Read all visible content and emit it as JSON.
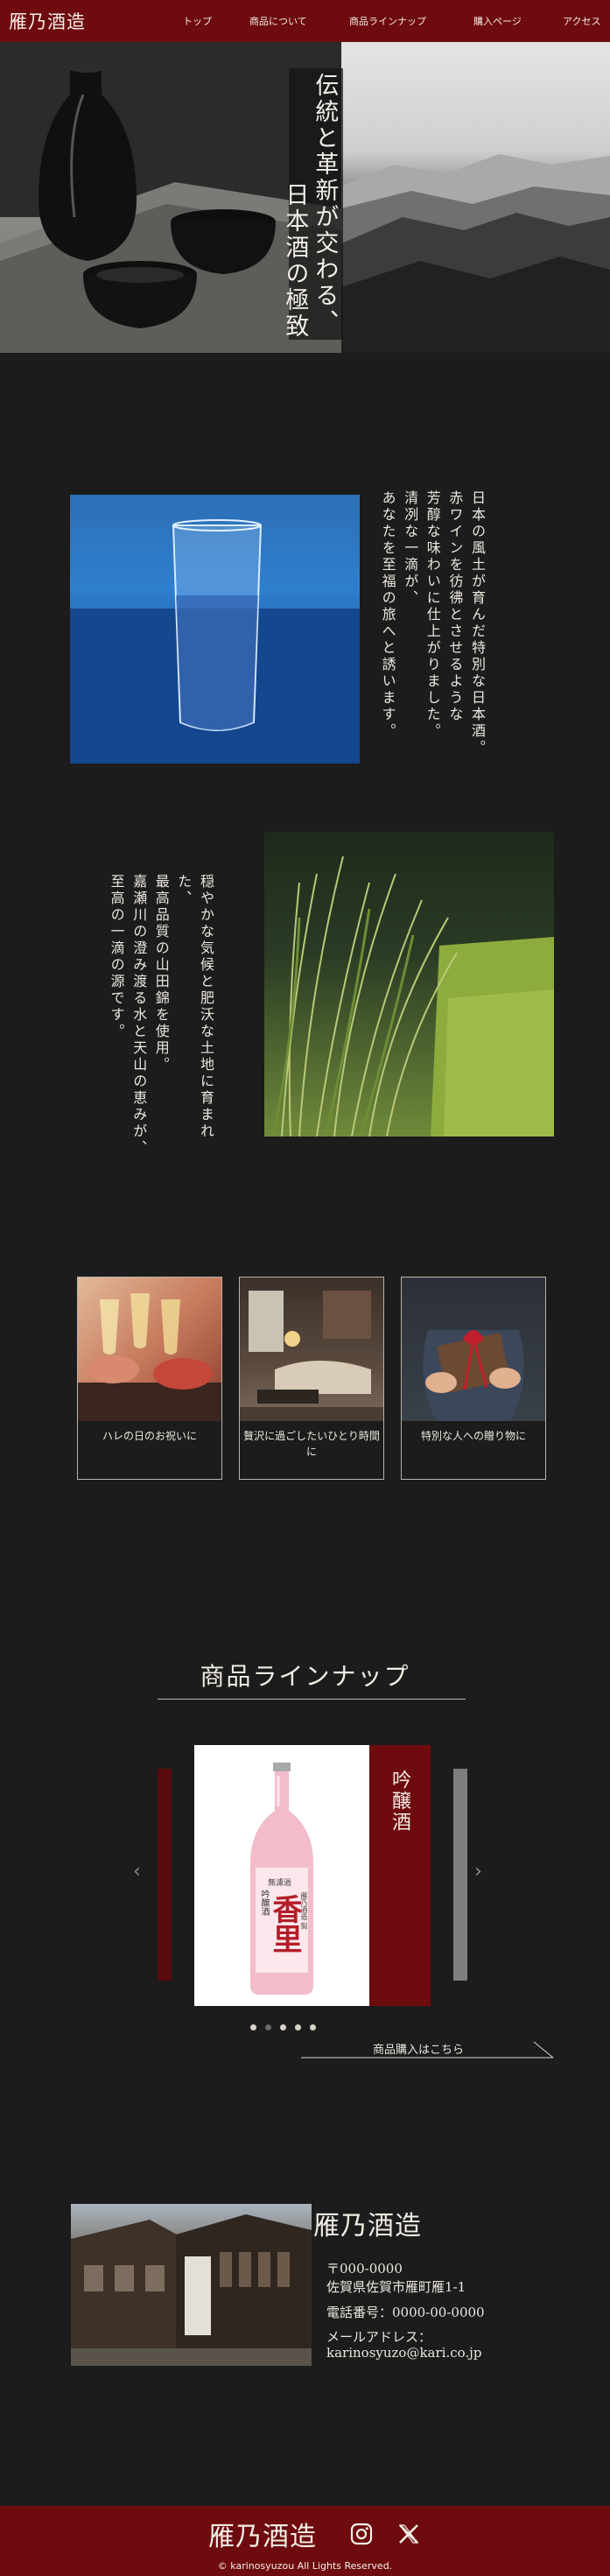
{
  "header": {
    "logo": "雁乃酒造",
    "nav": [
      "トップ",
      "商品について",
      "商品ラインナップ",
      "購入ページ",
      "アクセス"
    ]
  },
  "hero": {
    "caption_line1": "伝統と革新が交わる、",
    "caption_line2": "日本酒の極致"
  },
  "intro": {
    "lines": [
      "日本の風土が育んだ特別な日本酒。",
      "赤ワインを彷彿とさせるような",
      "芳醇な味わいに仕上がりました。",
      "清冽な一滴が、",
      "あなたを至福の旅へと誘います。"
    ]
  },
  "origin": {
    "lines": [
      "穏やかな気候と肥沃な土地に育まれた、",
      "最高品質の山田錦を使用。",
      "嘉瀬川の澄み渡る水と天山の恵みが、",
      "至高の一滴の源です。"
    ]
  },
  "scenes": [
    {
      "caption": "ハレの日のお祝いに"
    },
    {
      "caption": "贅沢に過ごしたいひとり時間に"
    },
    {
      "caption": "特別な人への贈り物に"
    }
  ],
  "lineup": {
    "title": "商品ラインナップ",
    "current_product": "吟醸酒",
    "bottle_label_top": "吟醸酒",
    "bottle_label_main": "香里",
    "bottle_label_small": "無濾過",
    "bottle_label_side": "雁乃酒造 製",
    "cta": "商品購入はこちら",
    "slide_count": 5,
    "active_slide": 1
  },
  "access": {
    "name": "雁乃酒造",
    "postal": "〒000-0000",
    "address": "佐賀県佐賀市雁町雁1-1",
    "phone": "電話番号：0000-00-0000",
    "mail_label": "メールアドレス：",
    "mail": "karinosyuzo@kari.co.jp"
  },
  "footer": {
    "logo": "雁乃酒造",
    "copyright": "© karinosyuzou All Lights Reserved.",
    "social_icons": [
      "instagram-icon",
      "x-icon"
    ]
  },
  "colors": {
    "brand": "#6e0b0f",
    "background": "#1b1c1b",
    "text": "#ece7df"
  }
}
